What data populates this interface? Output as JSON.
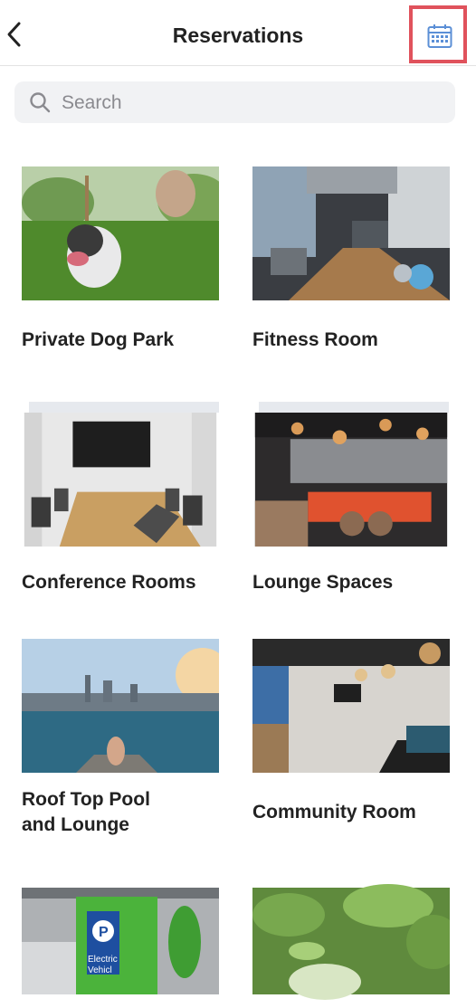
{
  "header": {
    "title": "Reservations",
    "back_icon": "chevron-left-icon",
    "calendar_icon": "calendar-icon",
    "accent_color": "#e0525c",
    "icon_color": "#5b8fd6"
  },
  "search": {
    "placeholder": "Search",
    "value": ""
  },
  "amenities": [
    {
      "label": "Private Dog Park"
    },
    {
      "label": "Fitness Room"
    },
    {
      "label": "Conference Rooms"
    },
    {
      "label": "Lounge Spaces"
    },
    {
      "label": "Roof Top Pool\nand Lounge"
    },
    {
      "label": "Community Room"
    },
    {
      "label": ""
    },
    {
      "label": ""
    }
  ]
}
